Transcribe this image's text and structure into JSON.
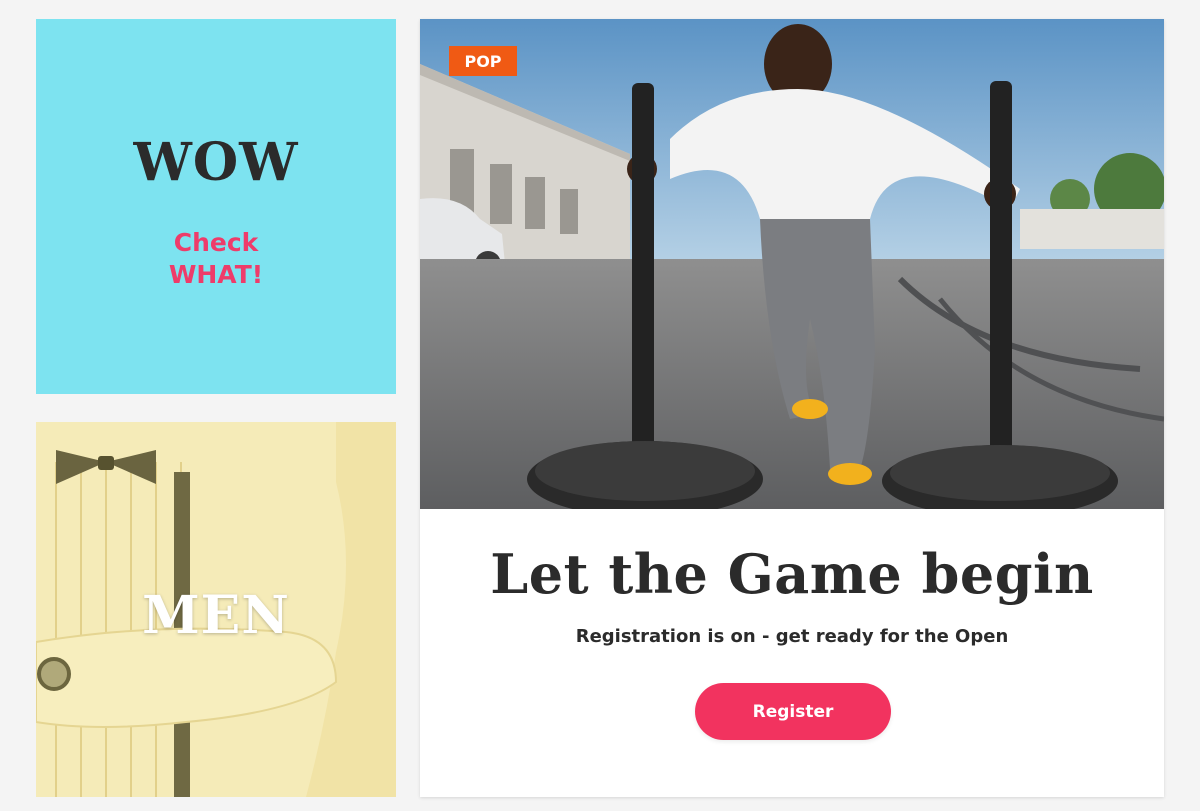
{
  "promo": {
    "title": "WOW",
    "subtitle_line1": "Check",
    "subtitle_line2": "WHAT!",
    "background_color": "#7de3f0",
    "subtitle_color": "#ee3c6a"
  },
  "men_tile": {
    "label": "MEN",
    "overlay_color": "#f0e0a0"
  },
  "feature": {
    "badge": "POP",
    "badge_color": "#f05a14",
    "headline": "Let the Game begin",
    "subline": "Registration is on - get ready for the Open",
    "cta_label": "Register",
    "cta_color": "#f2335f"
  }
}
